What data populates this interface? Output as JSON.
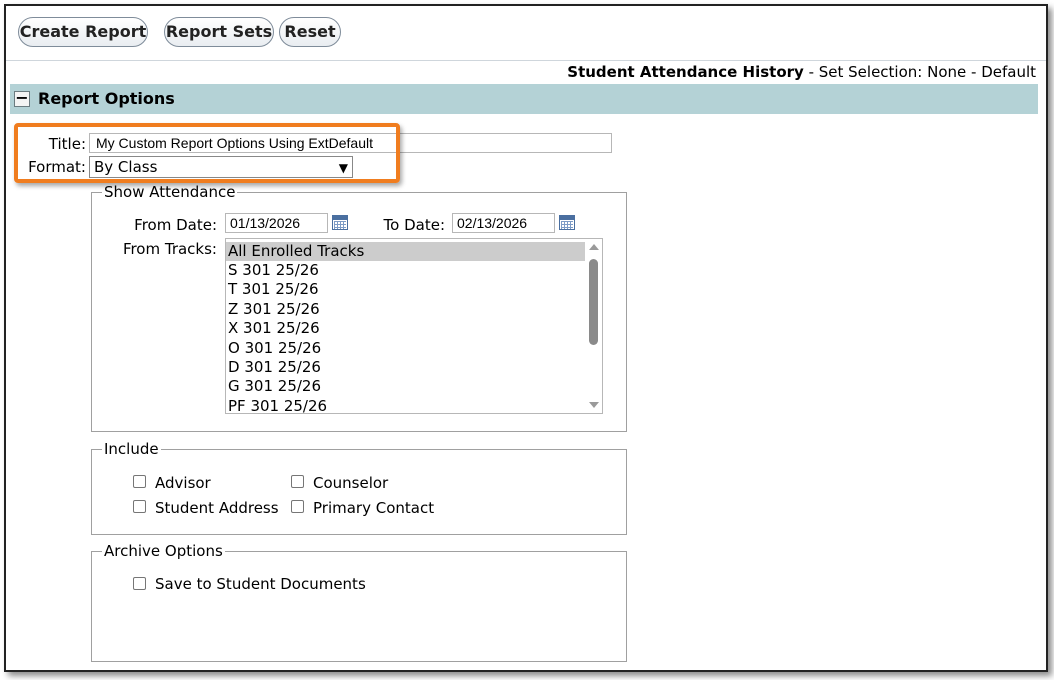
{
  "toolbar": {
    "create_report": "Create Report",
    "report_sets": "Report Sets",
    "reset": "Reset"
  },
  "heading": {
    "report_name": "Student Attendance History",
    "set_selection": " - Set Selection: None - Default"
  },
  "section": {
    "toggle": "−",
    "title": "Report Options"
  },
  "form": {
    "title_label": "Title:",
    "title_value": "My Custom Report Options Using ExtDefault",
    "format_label": "Format:",
    "format_value": "By Class"
  },
  "show_attendance": {
    "legend": "Show Attendance",
    "from_date_label": "From Date:",
    "from_date": "01/13/2026",
    "to_date_label": "To Date:",
    "to_date": "02/13/2026",
    "tracks_label": "From Tracks:",
    "tracks": [
      "All Enrolled Tracks",
      "S 301 25/26",
      "T 301 25/26",
      "Z 301 25/26",
      "X 301 25/26",
      "O 301 25/26",
      "D 301 25/26",
      "G 301 25/26",
      "PF 301 25/26"
    ]
  },
  "include": {
    "legend": "Include",
    "options": [
      "Advisor",
      "Counselor",
      "Student Address",
      "Primary Contact"
    ]
  },
  "archive": {
    "legend": "Archive Options",
    "save_label": "Save to Student Documents"
  },
  "colors": {
    "section_band": "#b4d2d6",
    "highlight": "#f07d1f"
  }
}
